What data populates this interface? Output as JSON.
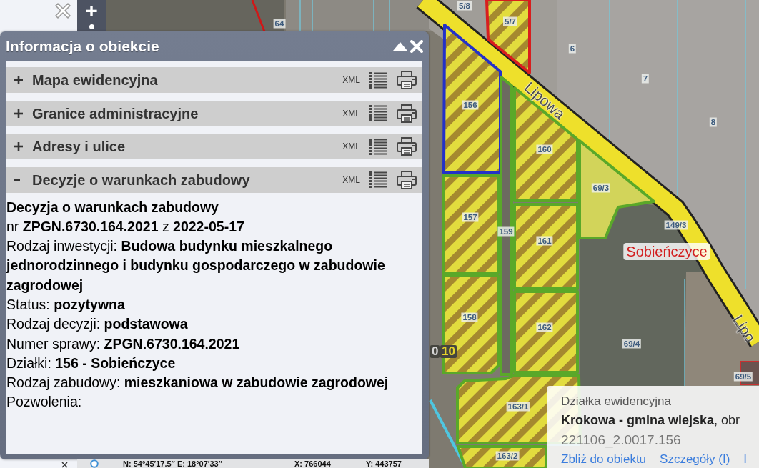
{
  "map_tools": {
    "zoom_in": "+"
  },
  "map": {
    "parcels": [
      {
        "number": "5/8",
        "kind": "plain",
        "selected": false
      },
      {
        "number": "5/7",
        "kind": "hatched",
        "color": "#d81e1e",
        "selected": false
      },
      {
        "number": "64",
        "kind": "plain",
        "selected": false
      },
      {
        "number": "6",
        "kind": "plain",
        "selected": false
      },
      {
        "number": "7",
        "kind": "plain",
        "selected": false
      },
      {
        "number": "156",
        "kind": "hatched",
        "selected": true
      },
      {
        "number": "8",
        "kind": "plain",
        "selected": false
      },
      {
        "number": "160",
        "kind": "hatched",
        "color": "#5aa829",
        "selected": false
      },
      {
        "number": "69/3",
        "kind": "filled",
        "color": "#5aa829",
        "selected": false
      },
      {
        "number": "157",
        "kind": "hatched",
        "color": "#5aa829",
        "selected": false
      },
      {
        "number": "149/3",
        "kind": "plain",
        "selected": false
      },
      {
        "number": "159",
        "kind": "outlined",
        "color": "#5aa829",
        "selected": false
      },
      {
        "number": "161",
        "kind": "hatched",
        "color": "#5aa829",
        "selected": false
      },
      {
        "number": "158",
        "kind": "hatched",
        "color": "#5aa829",
        "selected": false
      },
      {
        "number": "162",
        "kind": "hatched",
        "color": "#5aa829",
        "selected": false
      },
      {
        "number": "69/4",
        "kind": "plain",
        "selected": false
      },
      {
        "number": "69/5",
        "kind": "plain",
        "selected": false
      },
      {
        "number": "163/1",
        "kind": "hatched",
        "color": "#5aa829",
        "selected": false
      },
      {
        "number": "163/2",
        "kind": "hatched",
        "color": "#5aa829",
        "selected": false
      }
    ],
    "streets": [
      "Lipowa",
      "Lipo"
    ],
    "place": "Sobieńczyce",
    "marks": [
      {
        "text": "0",
        "kind": "plain"
      },
      {
        "text": "10",
        "kind": "highlight"
      }
    ]
  },
  "info_panel": {
    "title": "Informacja o obiekcie",
    "sections": [
      {
        "title": "Mapa ewidencyjna",
        "format": "XML",
        "expanded": false
      },
      {
        "title": "Granice administracyjne",
        "format": "XML",
        "expanded": false
      },
      {
        "title": "Adresy i ulice",
        "format": "XML",
        "expanded": false
      },
      {
        "title": "Decyzje o warunkach zabudowy",
        "format": "XML",
        "expanded": true,
        "details": {
          "heading": "Decyzja o warunkach zabudowy",
          "lines": [
            "nr **ZPGN.6730.164.2021** z **2022-05-17**",
            "Rodzaj inwestycji: **Budowa budynku mieszkalnego jednorodzinnego i budynku gospodarczego w zabudowie zagrodowej**",
            "Status: **pozytywna**",
            "Rodzaj decyzji: **podstawowa**",
            "Numer sprawy: **ZPGN.6730.164.2021**",
            "Działki: **156 - Sobieńczyce**",
            "Rodzaj zabudowy: **mieszkaniowa w zabudowie zagrodowej**",
            "Pozwolenia:"
          ]
        }
      }
    ]
  },
  "status_bar": {
    "coordinates": "N: 54°45′17.5″ E: 18°07′33″",
    "x": "X: 766044",
    "y": "Y: 443757"
  },
  "parcel_popup": {
    "title": "Działka ewidencyjna",
    "location": "**Krokowa - gmina wiejska**, obr",
    "id": "221106_2.0017.156",
    "links": [
      "Zbliż do obiektu",
      "Szczegóły (I)",
      "I"
    ]
  }
}
